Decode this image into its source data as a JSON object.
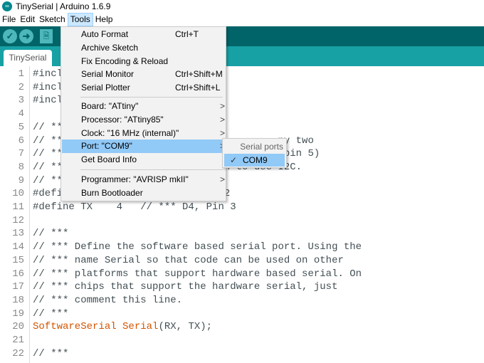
{
  "window": {
    "title": "TinySerial | Arduino 1.6.9"
  },
  "menubar": [
    "File",
    "Edit",
    "Sketch",
    "Tools",
    "Help"
  ],
  "toolbar": {
    "verify": "✓",
    "upload": "➜",
    "new": "🗎"
  },
  "tab": "TinySerial",
  "tools_menu": [
    {
      "label": "Auto Format",
      "shortcut": "Ctrl+T"
    },
    {
      "label": "Archive Sketch",
      "shortcut": ""
    },
    {
      "label": "Fix Encoding & Reload",
      "shortcut": ""
    },
    {
      "label": "Serial Monitor",
      "shortcut": "Ctrl+Shift+M"
    },
    {
      "label": "Serial Plotter",
      "shortcut": "Ctrl+Shift+L"
    },
    {
      "label": "Board: \"ATtiny\"",
      "arrow": ">"
    },
    {
      "label": "Processor: \"ATtiny85\"",
      "arrow": ">"
    },
    {
      "label": "Clock: \"16 MHz (internal)\"",
      "arrow": ">"
    },
    {
      "label": "Port: \"COM9\"",
      "arrow": ">"
    },
    {
      "label": "Get Board Info"
    },
    {
      "label": "Programmer: \"AVRISP mkII\"",
      "arrow": ">"
    },
    {
      "label": "Burn Bootloader"
    }
  ],
  "port_submenu": {
    "header": "Serial ports",
    "items": [
      {
        "label": "COM9",
        "checked": true,
        "check": "✓"
      }
    ]
  },
  "code": [
    {
      "n": "1",
      "t": "#incl"
    },
    {
      "n": "2",
      "t": "#incl"
    },
    {
      "n": "3",
      "t": "#incl"
    },
    {
      "n": "4",
      "t": ""
    },
    {
      "n": "5",
      "t": "// ***"
    },
    {
      "n": "6",
      "t": "// ***                                   ny two"
    },
    {
      "n": "7",
      "t": "// ***                                D0 (pin 5)"
    },
    {
      "n": "8",
      "t": "// ***                          n to use I2C."
    },
    {
      "n": "9",
      "t": "// ***"
    },
    {
      "n": "10",
      "t": "#defi                           2"
    },
    {
      "n": "11",
      "t": "#define TX    4   // *** D4, Pin 3"
    },
    {
      "n": "12",
      "t": ""
    },
    {
      "n": "13",
      "t": "// ***"
    },
    {
      "n": "14",
      "t": "// *** Define the software based serial port. Using the"
    },
    {
      "n": "15",
      "t": "// *** name Serial so that code can be used on other"
    },
    {
      "n": "16",
      "t": "// *** platforms that support hardware based serial. On"
    },
    {
      "n": "17",
      "t": "// *** chips that support the hardware serial, just"
    },
    {
      "n": "18",
      "t": "// *** comment this line."
    },
    {
      "n": "19",
      "t": "// ***"
    },
    {
      "n": "20",
      "kw": "SoftwareSerial Serial",
      "t": "(RX, TX);"
    },
    {
      "n": "21",
      "t": ""
    },
    {
      "n": "22",
      "t": "// ***"
    }
  ]
}
